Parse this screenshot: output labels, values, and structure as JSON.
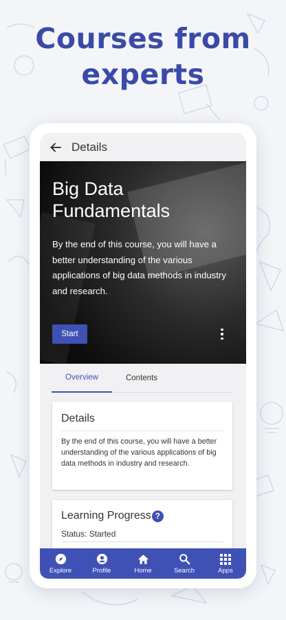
{
  "headline": {
    "line1": "Courses from",
    "line2": "experts"
  },
  "appbar": {
    "title": "Details"
  },
  "hero": {
    "title_line1": "Big Data",
    "title_line2": "Fundamentals",
    "description": "By the end of this course, you will have a better understanding of the various applications of big data methods in industry and research.",
    "start_label": "Start"
  },
  "tabs": [
    {
      "label": "Overview",
      "active": true
    },
    {
      "label": "Contents",
      "active": false
    }
  ],
  "details_card": {
    "title": "Details",
    "body": "By the end of this course, you will have a better understanding of the various applications of big data methods in industry and research."
  },
  "progress_card": {
    "title": "Learning Progress",
    "help_glyph": "?",
    "status": "Status: Started"
  },
  "bottom_nav": [
    {
      "label": "Explore",
      "icon": "compass-icon"
    },
    {
      "label": "Profile",
      "icon": "account-icon"
    },
    {
      "label": "Home",
      "icon": "home-icon"
    },
    {
      "label": "Search",
      "icon": "search-icon"
    },
    {
      "label": "Apps",
      "icon": "apps-grid-icon"
    }
  ],
  "colors": {
    "brand": "#3f51b5",
    "headline": "#3b4aa8",
    "background": "#f3f5f8"
  }
}
